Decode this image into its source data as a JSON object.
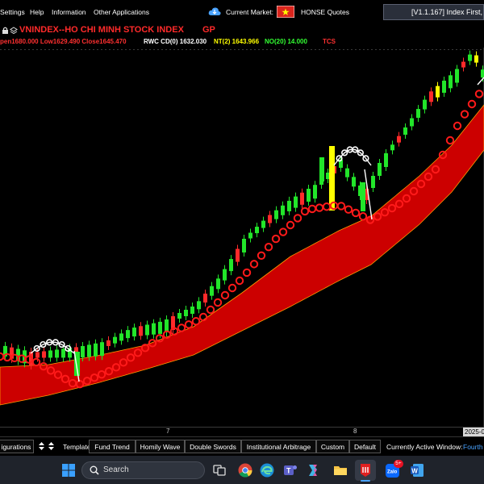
{
  "menu": {
    "settings": "Settings",
    "help": "Help",
    "information": "Information",
    "other_applications": "Other Applications",
    "current_market_label": "Current Market:",
    "quotes_source": "HONSE Quotes",
    "version_text": "[V1.1.167] Index First,"
  },
  "title": {
    "index_name": "VNINDEX--HO CHI MINH STOCK INDEX",
    "suffix": "GP"
  },
  "infobar": {
    "ohlc": "pen1680.000 Low1629.490 Close1645.470",
    "rwc": "RWC CD(0) 1632.030",
    "nt": "NT(2) 1643.966",
    "no": "NO(20) 14.000",
    "tcs": "TCS"
  },
  "xaxis": {
    "labels": [
      "7",
      "8",
      "2025-0"
    ]
  },
  "bottombar": {
    "configurations": "igurations",
    "template_label": "Template",
    "templates": [
      "Fund Trend",
      "Homily Wave",
      "Double Swords",
      "Institutional Arbitrage",
      "Custom",
      "Default"
    ],
    "active_window_label": "Currently Active Window:",
    "active_window_value": "Fourth"
  },
  "taskbar": {
    "search_placeholder": "Search",
    "zalo_badge": "5+"
  },
  "colors": {
    "up_candle": "#22e62a",
    "down_candle": "#ff2a2a",
    "flat_candle": "#ffff00",
    "ribbon": "#cc0000",
    "ribbon_edge": "#ff9900",
    "ring": "#ff1a1a",
    "arc": "#ffffff",
    "infobar_red": "#ff3030",
    "infobar_yellow": "#ffff00",
    "infobar_green": "#33ff33"
  }
}
